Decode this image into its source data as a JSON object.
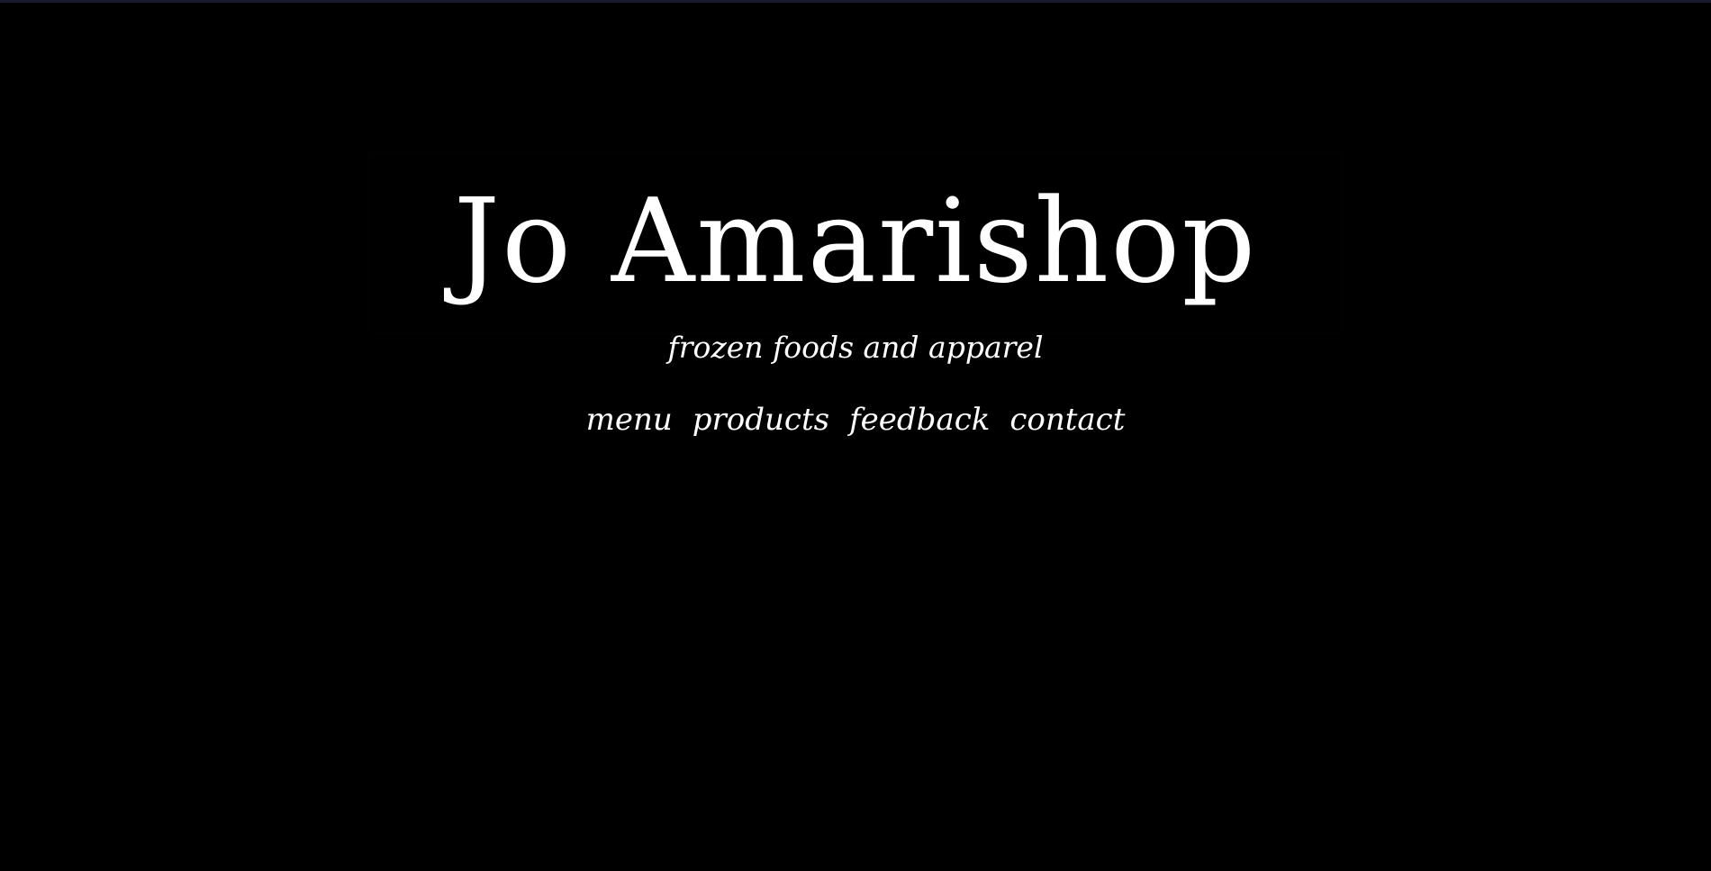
{
  "header": {
    "brand_name": "Jo Amarishop",
    "tagline": "frozen foods and apparel"
  },
  "nav": {
    "items": [
      {
        "label": "menu"
      },
      {
        "label": "products"
      },
      {
        "label": "feedback"
      },
      {
        "label": "contact"
      }
    ]
  },
  "colors": {
    "background": "#000000",
    "text": "#ffffff",
    "top_border": "#1a1a2e"
  }
}
